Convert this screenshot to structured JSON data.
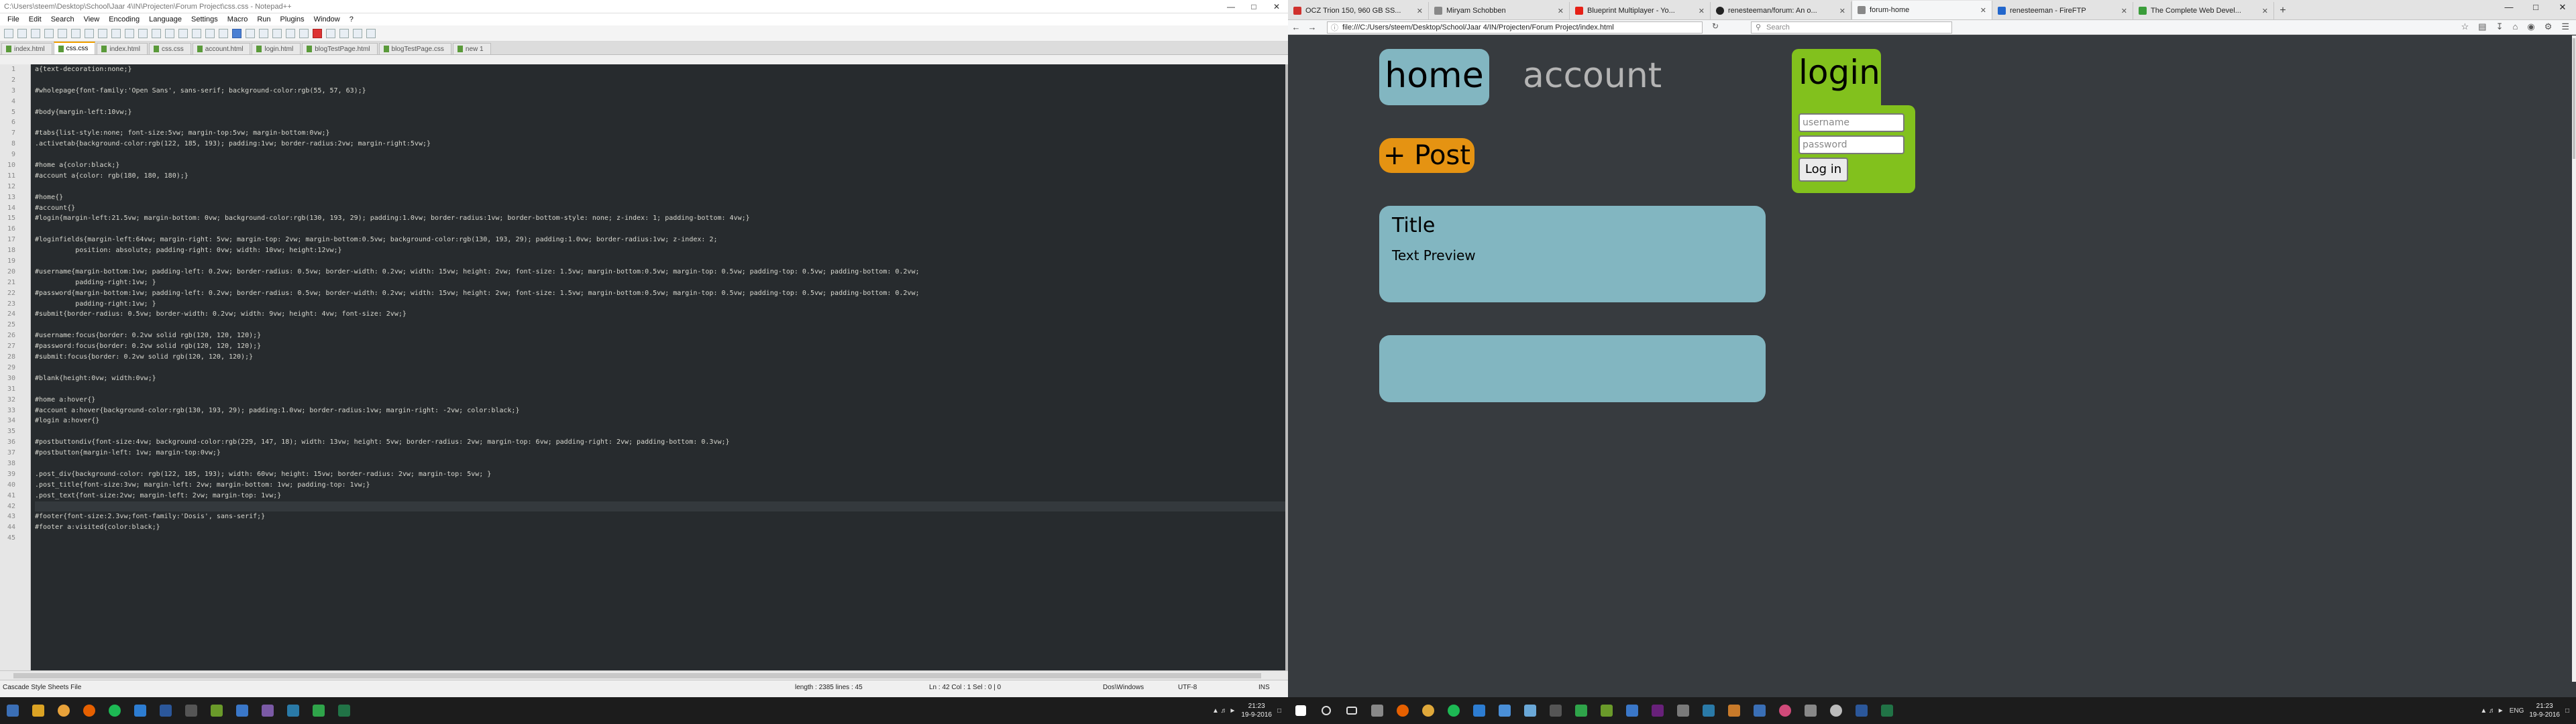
{
  "npp": {
    "title": "C:\\Users\\steem\\Desktop\\School\\Jaar 4\\IN\\Projecten\\Forum Project\\css.css - Notepad++",
    "menu": [
      "File",
      "Edit",
      "Search",
      "View",
      "Encoding",
      "Language",
      "Settings",
      "Macro",
      "Run",
      "Plugins",
      "Window",
      "?"
    ],
    "tabs": [
      "index.html",
      "css.css",
      "index.html",
      "css.css",
      "account.html",
      "login.html",
      "blogTestPage.html",
      "blogTestPage.css",
      "new 1"
    ],
    "active_tab": 1,
    "code": [
      "a{text-decoration:none;}",
      "",
      "#wholepage{font-family:'Open Sans', sans-serif; background-color:rgb(55, 57, 63);}",
      "",
      "#body{margin-left:10vw;}",
      "",
      "#tabs{list-style:none; font-size:5vw; margin-top:5vw; margin-bottom:0vw;}",
      ".activetab{background-color:rgb(122, 185, 193); padding:1vw; border-radius:2vw; margin-right:5vw;}",
      "",
      "#home a{color:black;}",
      "#account a{color: rgb(180, 180, 180);}",
      "",
      "#home{}",
      "#account{}",
      "#login{margin-left:21.5vw; margin-bottom: 0vw; background-color:rgb(130, 193, 29); padding:1.0vw; border-radius:1vw; border-bottom-style: none; z-index: 1; padding-bottom: 4vw;}",
      "",
      "#loginfields{margin-left:64vw; margin-right: 5vw; margin-top: 2vw; margin-bottom:0.5vw; background-color:rgb(130, 193, 29); padding:1.0vw; border-radius:1vw; z-index: 2;",
      "          position: absolute; padding-right: 0vw; width: 10vw; height:12vw;}",
      "",
      "#username{margin-bottom:1vw; padding-left: 0.2vw; border-radius: 0.5vw; border-width: 0.2vw; width: 15vw; height: 2vw; font-size: 1.5vw; margin-bottom:0.5vw; margin-top: 0.5vw; padding-top: 0.5vw; padding-bottom: 0.2vw;",
      "          padding-right:1vw; }",
      "#password{margin-bottom:1vw; padding-left: 0.2vw; border-radius: 0.5vw; border-width: 0.2vw; width: 15vw; height: 2vw; font-size: 1.5vw; margin-bottom:0.5vw; margin-top: 0.5vw; padding-top: 0.5vw; padding-bottom: 0.2vw;",
      "          padding-right:1vw; }",
      "#submit{border-radius: 0.5vw; border-width: 0.2vw; width: 9vw; height: 4vw; font-size: 2vw;}",
      "",
      "#username:focus{border: 0.2vw solid rgb(120, 120, 120);}",
      "#password:focus{border: 0.2vw solid rgb(120, 120, 120);}",
      "#submit:focus{border: 0.2vw solid rgb(120, 120, 120);}",
      "",
      "#blank{height:0vw; width:0vw;}",
      "",
      "#home a:hover{}",
      "#account a:hover{background-color:rgb(130, 193, 29); padding:1.0vw; border-radius:1vw; margin-right: -2vw; color:black;}",
      "#login a:hover{}",
      "",
      "#postbuttondiv{font-size:4vw; background-color:rgb(229, 147, 18); width: 13vw; height: 5vw; border-radius: 2vw; margin-top: 6vw; padding-right: 2vw; padding-bottom: 0.3vw;}",
      "#postbutton{margin-left: 1vw; margin-top:0vw;}",
      "",
      ".post_div{background-color: rgb(122, 185, 193); width: 60vw; height: 15vw; border-radius: 2vw; margin-top: 5vw; }",
      ".post_title{font-size:3vw; margin-left: 2vw; margin-bottom: 1vw; padding-top: 1vw;}",
      ".post_text{font-size:2vw; margin-left: 2vw; margin-top: 1vw;}",
      "",
      "#footer{font-size:2.3vw;font-family:'Dosis', sans-serif;}",
      "#footer a:visited{color:black;}",
      ""
    ],
    "current_line": 42,
    "status": {
      "type": "Cascade Style Sheets File",
      "length": "length : 2385    lines : 45",
      "pos": "Ln : 42    Col : 1    Sel : 0 | 0",
      "eol": "Dos\\Windows",
      "enc": "UTF-8",
      "mode": "INS"
    }
  },
  "firefox": {
    "tabs": [
      {
        "label": "OCZ Trion 150, 960 GB SS...",
        "color": "#d0312d"
      },
      {
        "label": "Miryam Schobben",
        "color": "#888888"
      },
      {
        "label": "Blueprint Multiplayer - Yo...",
        "color": "#e62117"
      },
      {
        "label": "renesteeman/forum: An o...",
        "color": "#222222"
      },
      {
        "label": "forum-home",
        "color": "#888888"
      },
      {
        "label": "renesteeman - FireFTP",
        "color": "#2266cc"
      },
      {
        "label": "The Complete Web Devel...",
        "color": "#3a9d3a"
      }
    ],
    "active_tab": 4,
    "url": "file:///C:/Users/steem/Desktop/School/Jaar 4/IN/Projecten/Forum Project/index.html",
    "search_placeholder": "Search"
  },
  "forum": {
    "tab_home": "home",
    "tab_account": "account",
    "post_button": "+ Post",
    "post": {
      "title": "Title",
      "text": "Text Preview"
    },
    "login": {
      "tab_label": "login",
      "username_placeholder": "username",
      "password_placeholder": "password",
      "submit_label": "Log in"
    },
    "colors": {
      "home": "#82b6c1",
      "login": "#82c11d",
      "post": "#e59312",
      "background": "#373b3f"
    }
  },
  "taskbar": {
    "left_clock": {
      "time": "21:23",
      "date": "19-9-2016"
    },
    "right_clock": {
      "time": "21:23",
      "date": "19-9-2016"
    },
    "lang": "ENG"
  }
}
